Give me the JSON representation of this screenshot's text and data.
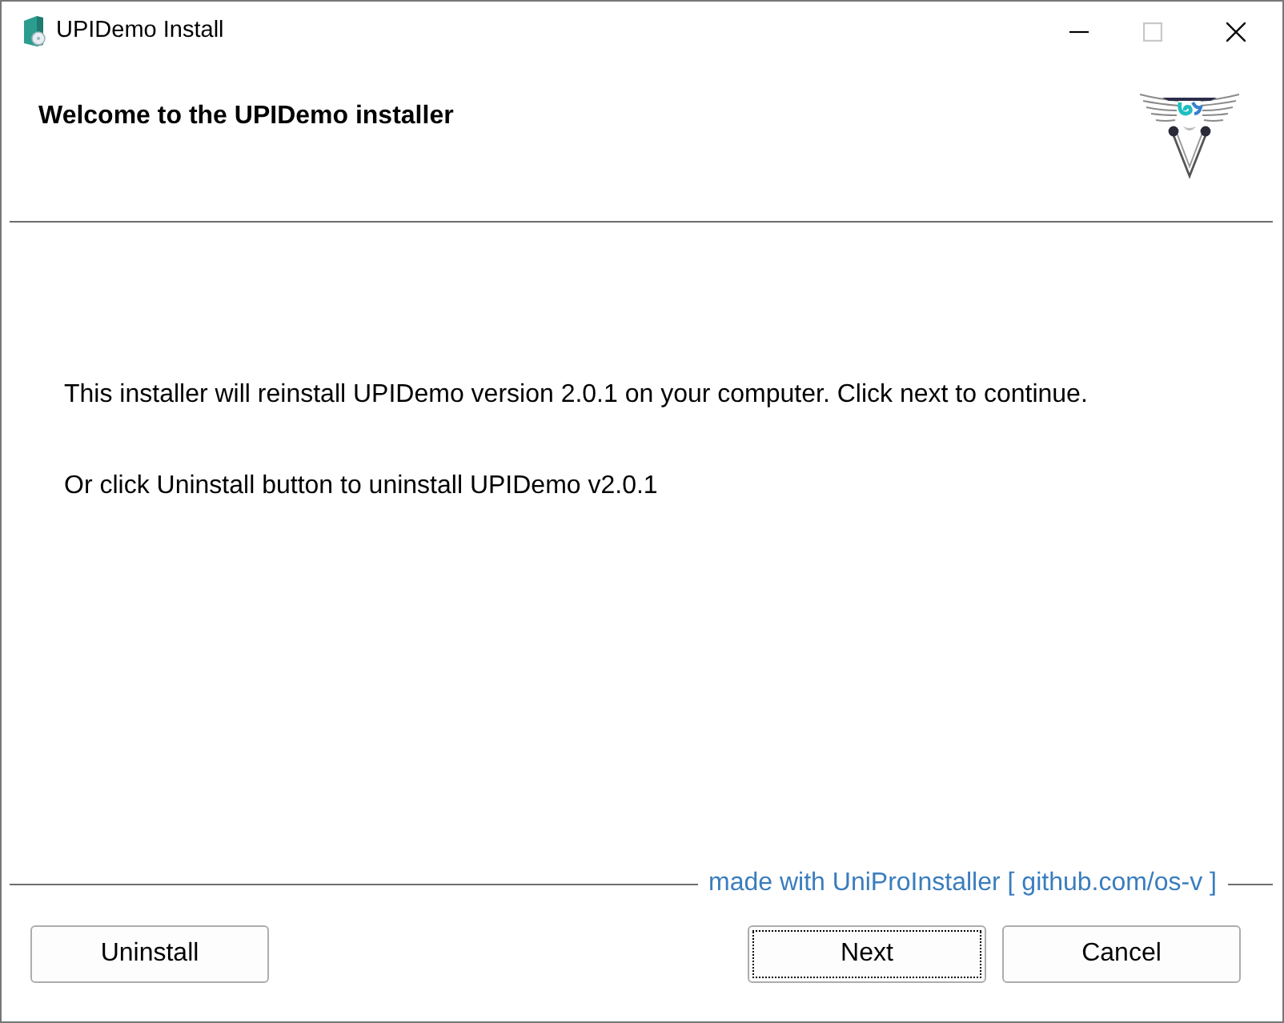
{
  "window": {
    "title": "UPIDemo Install",
    "controls": [
      {
        "kind": "minimize",
        "disabled": false
      },
      {
        "kind": "maximize",
        "disabled": true
      },
      {
        "kind": "close",
        "disabled": false
      }
    ]
  },
  "header": {
    "title": "Welcome to the UPIDemo installer"
  },
  "body": {
    "paragraphs": [
      "This installer will reinstall UPIDemo version 2.0.1 on your computer. Click next to continue.",
      "Or click Uninstall button to uninstall UPIDemo v2.0.1"
    ]
  },
  "footer": {
    "credit": "made with UniProInstaller [ github.com/os-v ]"
  },
  "buttons": [
    {
      "label": "Uninstall",
      "focused": false
    },
    {
      "label": "Next",
      "focused": true
    },
    {
      "label": "Cancel",
      "focused": false
    }
  ]
}
